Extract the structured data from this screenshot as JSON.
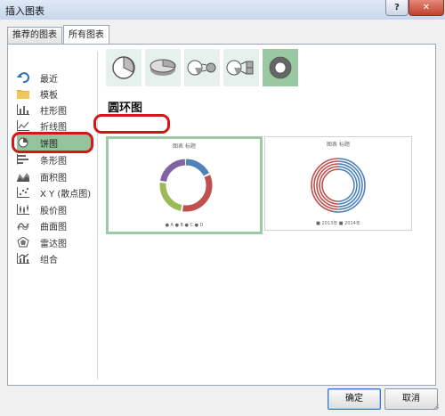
{
  "window": {
    "title": "插入图表",
    "help": "?",
    "close": "✕"
  },
  "tabs": [
    {
      "label": "推荐的图表"
    },
    {
      "label": "所有图表"
    }
  ],
  "sidebar": {
    "items": [
      {
        "label": "最近"
      },
      {
        "label": "模板"
      },
      {
        "label": "柱形图"
      },
      {
        "label": "折线图"
      },
      {
        "label": "饼图"
      },
      {
        "label": "条形图"
      },
      {
        "label": "面积图"
      },
      {
        "label": "X Y (散点图)"
      },
      {
        "label": "股价图"
      },
      {
        "label": "曲面图"
      },
      {
        "label": "雷达图"
      },
      {
        "label": "组合"
      }
    ],
    "selected_index": 4
  },
  "section": {
    "title": "圆环图"
  },
  "previews": [
    {
      "title": "图表 标题",
      "legend": "● A  ● B  ● C  ● D"
    },
    {
      "title": "图表 标题",
      "legend": "■ 2013年  ■ 2014年"
    }
  ],
  "buttons": {
    "ok": "确定",
    "cancel": "取消"
  },
  "colors": {
    "accent_green": "#94c49d",
    "highlight_red": "#d01818",
    "donut_blue": "#4f81bd",
    "donut_red": "#c0504d",
    "donut_green": "#9bbb59",
    "donut_purple": "#8064a2"
  }
}
